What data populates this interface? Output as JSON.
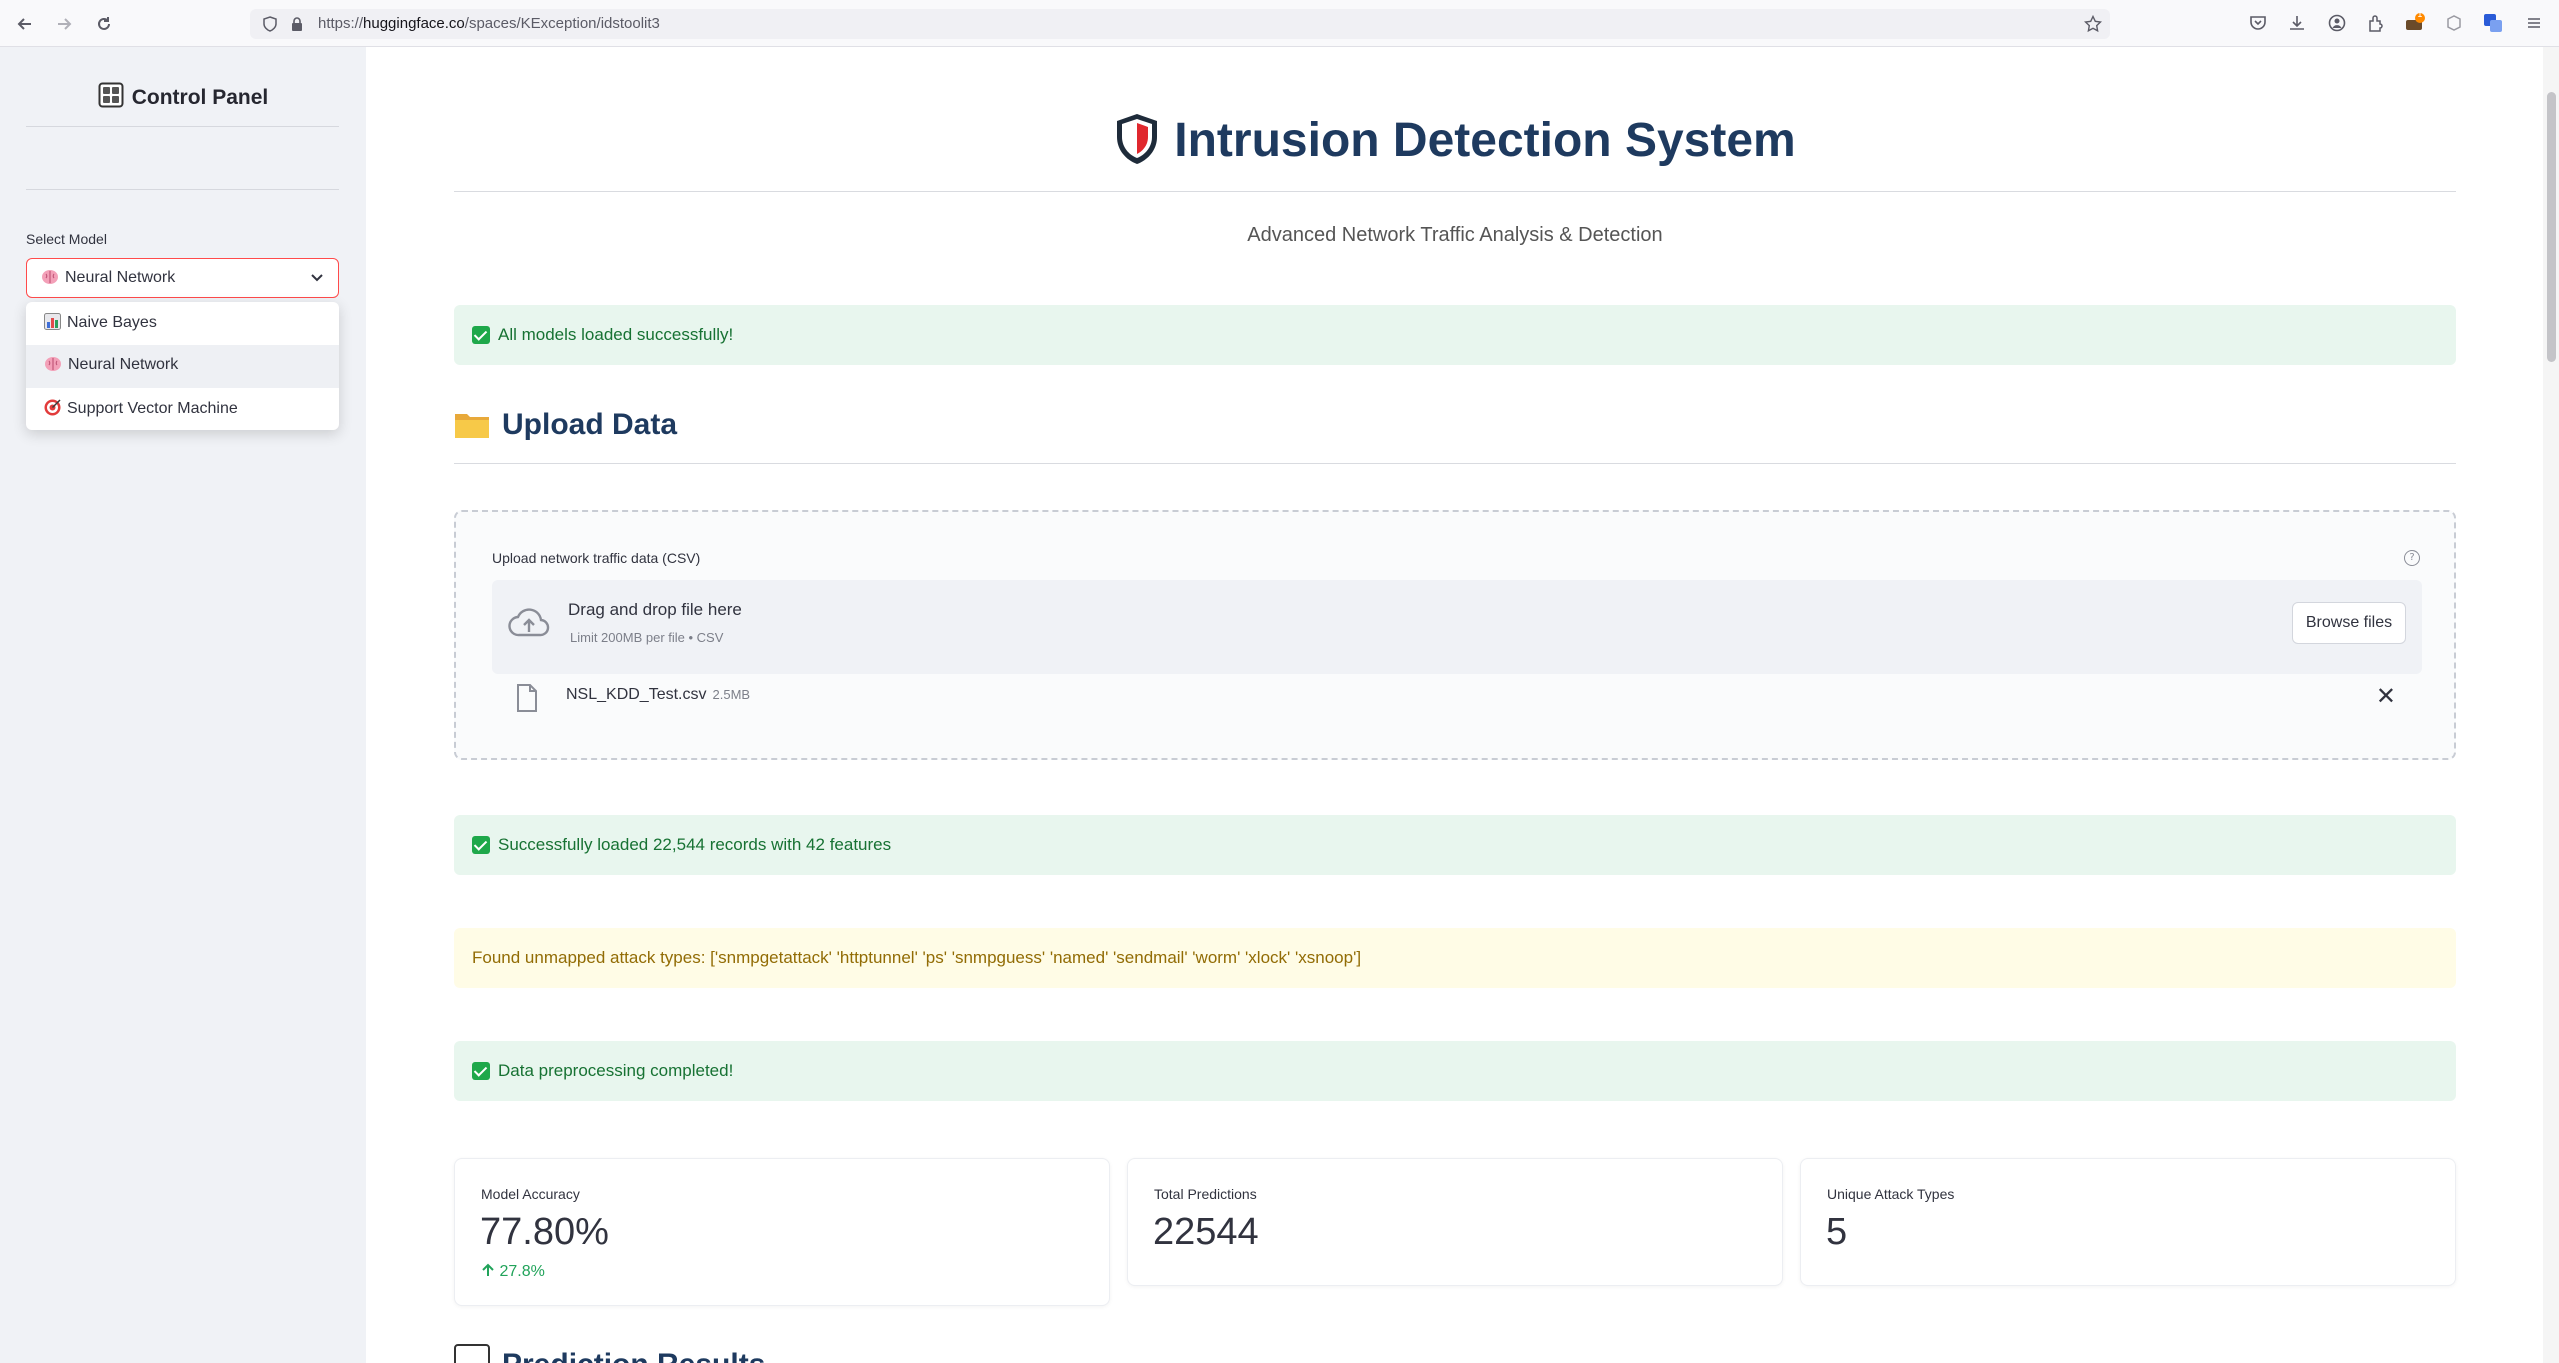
{
  "browser": {
    "url_prefix": "https://",
    "url_host": "huggingface.co",
    "url_path": "/spaces/KException/idstoolit3",
    "notification_count": "1"
  },
  "sidebar": {
    "title": "Control Panel",
    "select_label": "Select Model",
    "selected_model": "Neural Network",
    "options": [
      {
        "label": "Naive Bayes",
        "icon": "bar-chart-icon"
      },
      {
        "label": "Neural Network",
        "icon": "brain-icon"
      },
      {
        "label": "Support Vector Machine",
        "icon": "target-icon"
      }
    ]
  },
  "header": {
    "title": "Intrusion Detection System",
    "subtitle": "Advanced Network Traffic Analysis & Detection",
    "icon": "shield-icon"
  },
  "alerts": {
    "models_loaded": "All models loaded successfully!",
    "records_loaded": "Successfully loaded 22,544 records with 42 features",
    "unmapped_warning": "Found unmapped attack types: ['snmpgetattack' 'httptunnel' 'ps' 'snmpguess' 'named' 'sendmail' 'worm' 'xlock' 'xsnoop']",
    "preprocessing_done": "Data preprocessing completed!"
  },
  "upload": {
    "section_title": "Upload Data",
    "label": "Upload network traffic data (CSV)",
    "drop_text": "Drag and drop file here",
    "limit_text": "Limit 200MB per file • CSV",
    "browse_label": "Browse files",
    "file_name": "NSL_KDD_Test.csv",
    "file_size": "2.5MB"
  },
  "metrics": [
    {
      "label": "Model Accuracy",
      "value": "77.80%",
      "delta": "27.8%"
    },
    {
      "label": "Total Predictions",
      "value": "22544"
    },
    {
      "label": "Unique Attack Types",
      "value": "5"
    }
  ],
  "next_section_title": "Prediction Results",
  "colors": {
    "accent": "#ff4b4b",
    "heading": "#1e3a5f",
    "success_bg": "#e8f6ee",
    "warning_bg": "#fffce6",
    "sidebar_bg": "#f0f2f6"
  }
}
